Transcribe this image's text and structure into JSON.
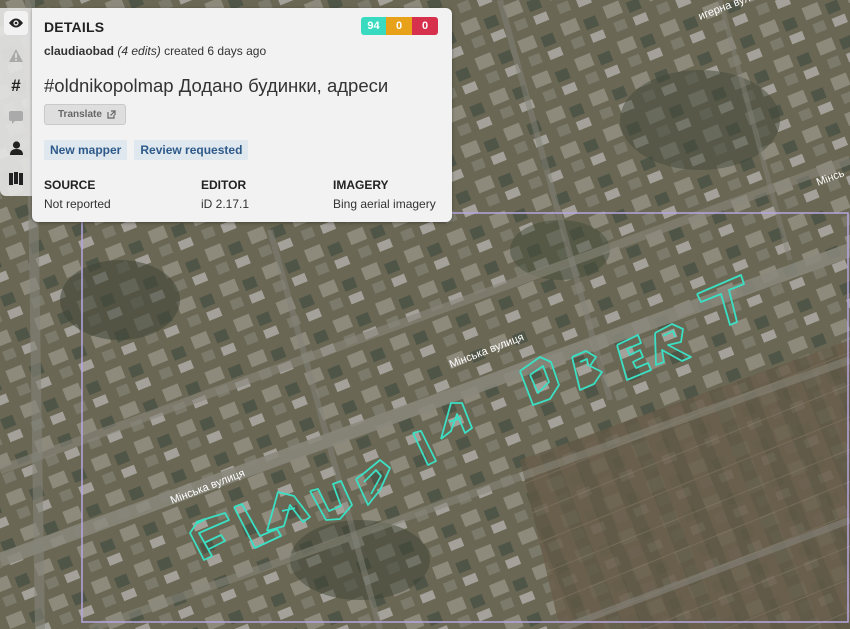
{
  "rail": {
    "icons": [
      "eye-icon",
      "warning-icon",
      "hashtag-icon",
      "comment-icon",
      "user-icon",
      "map-icon"
    ]
  },
  "details": {
    "title": "DETAILS",
    "scores": [
      "94",
      "0",
      "0"
    ],
    "username": "claudiaobad",
    "edits": "(4 edits)",
    "created": "created 6 days ago",
    "comment": "#oldnikopolmap Додано будинки, адреси",
    "translate_label": "Translate",
    "tags": [
      "New mapper",
      "Review requested"
    ],
    "source": {
      "label": "SOURCE",
      "value": "Not reported"
    },
    "editor": {
      "label": "EDITOR",
      "value": "iD 2.17.1"
    },
    "imagery": {
      "label": "IMAGERY",
      "value": "Bing aerial imagery"
    }
  },
  "map": {
    "street_labels": [
      "Мінська вулиця",
      "Мінська вулиця",
      "Мінська вулиця",
      "Мінсь",
      "игерна вулиця"
    ]
  },
  "colors": {
    "bbox": "#b6a6e0",
    "drawn_lines": "#3be0c4",
    "tag_text": "#2e5a8a"
  }
}
